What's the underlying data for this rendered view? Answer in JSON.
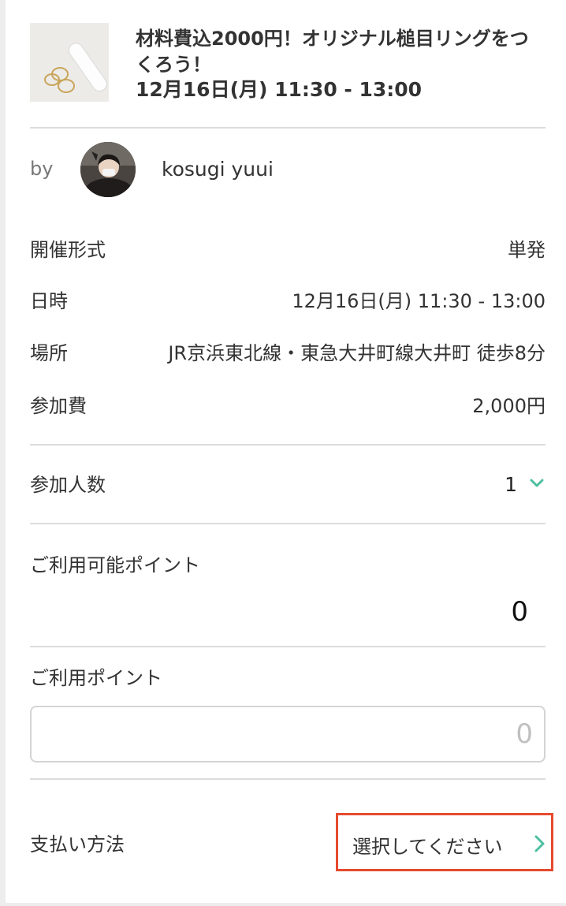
{
  "event": {
    "title": "材料費込2000円！オリジナル槌目リングをつくろう！",
    "datetime": "12月16日(月) 11:30 - 13:00"
  },
  "host": {
    "by_label": "by",
    "name": "kosugi yuui"
  },
  "details": [
    {
      "label": "開催形式",
      "value": "単発"
    },
    {
      "label": "日時",
      "value": "12月16日(月) 11:30 - 13:00"
    },
    {
      "label": "場所",
      "value": "JR京浜東北線・東急大井町線大井町 徒歩8分"
    },
    {
      "label": "参加費",
      "value": "2,000円"
    }
  ],
  "participants": {
    "label": "参加人数",
    "value": "1"
  },
  "available_points": {
    "label": "ご利用可能ポイント",
    "value": "0"
  },
  "use_points": {
    "label": "ご利用ポイント",
    "placeholder": "0"
  },
  "payment": {
    "label": "支払い方法",
    "select_text": "選択してください"
  },
  "colors": {
    "accent": "#4cbf9f",
    "highlight_border": "#e64a2e",
    "divider": "#dcdcdc"
  },
  "icons": {
    "participants_toggle": "chevron-down-icon",
    "payment_arrow": "chevron-right-icon"
  }
}
